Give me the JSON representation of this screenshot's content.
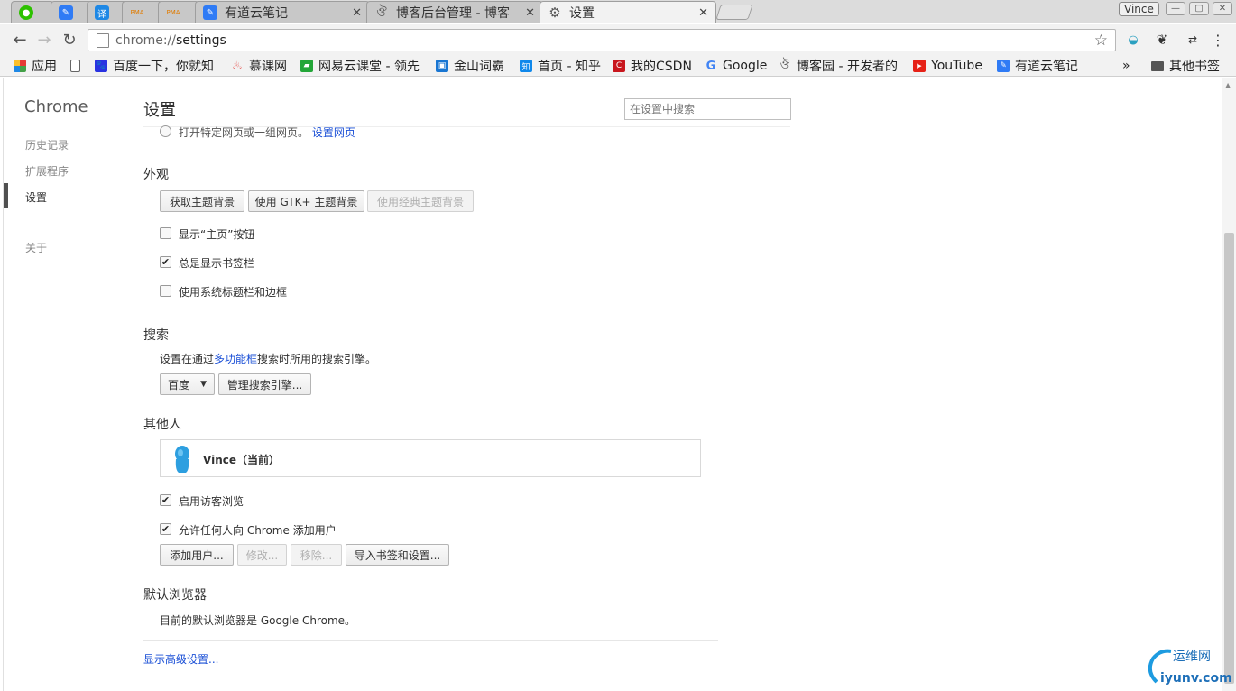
{
  "tabs": [
    {
      "title": "",
      "icon": "wechat-icon",
      "color": "#2dc100"
    },
    {
      "title": "",
      "icon": "youdao-note-icon",
      "color": "#2f7bf5"
    },
    {
      "title": "",
      "icon": "translate-icon",
      "color": "#1e88e5",
      "glyph": "译"
    },
    {
      "title": "",
      "icon": "phpmyadmin-icon",
      "color": "#f29100",
      "glyph": "PMA"
    },
    {
      "title": "",
      "icon": "phpmyadmin-icon",
      "color": "#f29100",
      "glyph": "PMA"
    },
    {
      "title": "有道云笔记",
      "icon": "youdao-note-icon",
      "color": "#2f7bf5"
    },
    {
      "title": "博客后台管理 - 博客",
      "icon": "cnblogs-icon",
      "color": "#555555"
    },
    {
      "title": "设置",
      "icon": "gear-icon",
      "color": "#555555",
      "active": true
    }
  ],
  "profile_name": "Vince",
  "address": {
    "scheme": "chrome://",
    "path": "settings"
  },
  "bookmarks": [
    {
      "label": "应用",
      "icon": "apps-grid-icon"
    },
    {
      "label": "百度一下，你就知",
      "icon": "baidu-icon"
    },
    {
      "label": "慕课网",
      "icon": "imooc-icon"
    },
    {
      "label": "网易云课堂 - 领先",
      "icon": "netease-study-icon"
    },
    {
      "label": "金山词霸",
      "icon": "iciba-icon"
    },
    {
      "label": "首页 - 知乎",
      "icon": "zhihu-icon"
    },
    {
      "label": "我的CSDN",
      "icon": "csdn-icon"
    },
    {
      "label": "Google",
      "icon": "google-icon"
    },
    {
      "label": "博客园 - 开发者的",
      "icon": "cnblogs-icon"
    },
    {
      "label": "YouTube",
      "icon": "youtube-icon"
    },
    {
      "label": "有道云笔记",
      "icon": "youdao-note-icon"
    }
  ],
  "bookmarks_overflow": "»",
  "other_bookmarks": "其他书签",
  "sidebar": {
    "brand": "Chrome",
    "items": [
      "历史记录",
      "扩展程序",
      "设置",
      "关于"
    ],
    "selected": "设置"
  },
  "settings": {
    "title": "设置",
    "search_placeholder": "在设置中搜索",
    "startup": {
      "option_text": "打开特定网页或一组网页。",
      "link": "设置网页"
    },
    "appearance": {
      "heading": "外观",
      "buttons": [
        "获取主题背景",
        "使用 GTK+ 主题背景",
        "使用经典主题背景"
      ],
      "checkboxes": [
        {
          "label": "显示“主页”按钮",
          "checked": false
        },
        {
          "label": "总是显示书签栏",
          "checked": true
        },
        {
          "label": "使用系统标题栏和边框",
          "checked": false
        }
      ]
    },
    "search": {
      "heading": "搜索",
      "desc_prefix": "设置在通过",
      "desc_link": "多功能框",
      "desc_suffix": "搜索时所用的搜索引擎。",
      "engine": "百度",
      "manage_button": "管理搜索引擎..."
    },
    "people": {
      "heading": "其他人",
      "current_user": "Vince（当前）",
      "checkboxes": [
        {
          "label": "启用访客浏览",
          "checked": true
        },
        {
          "label": "允许任何人向 Chrome 添加用户",
          "checked": true
        }
      ],
      "buttons": [
        {
          "label": "添加用户...",
          "disabled": false
        },
        {
          "label": "修改...",
          "disabled": true
        },
        {
          "label": "移除...",
          "disabled": true
        },
        {
          "label": "导入书签和设置...",
          "disabled": false
        }
      ]
    },
    "default_browser": {
      "heading": "默认浏览器",
      "text": "目前的默认浏览器是 Google Chrome。"
    },
    "advanced_link": "显示高级设置..."
  },
  "watermark": {
    "cn": "运维网",
    "en": "iyunv.com"
  }
}
